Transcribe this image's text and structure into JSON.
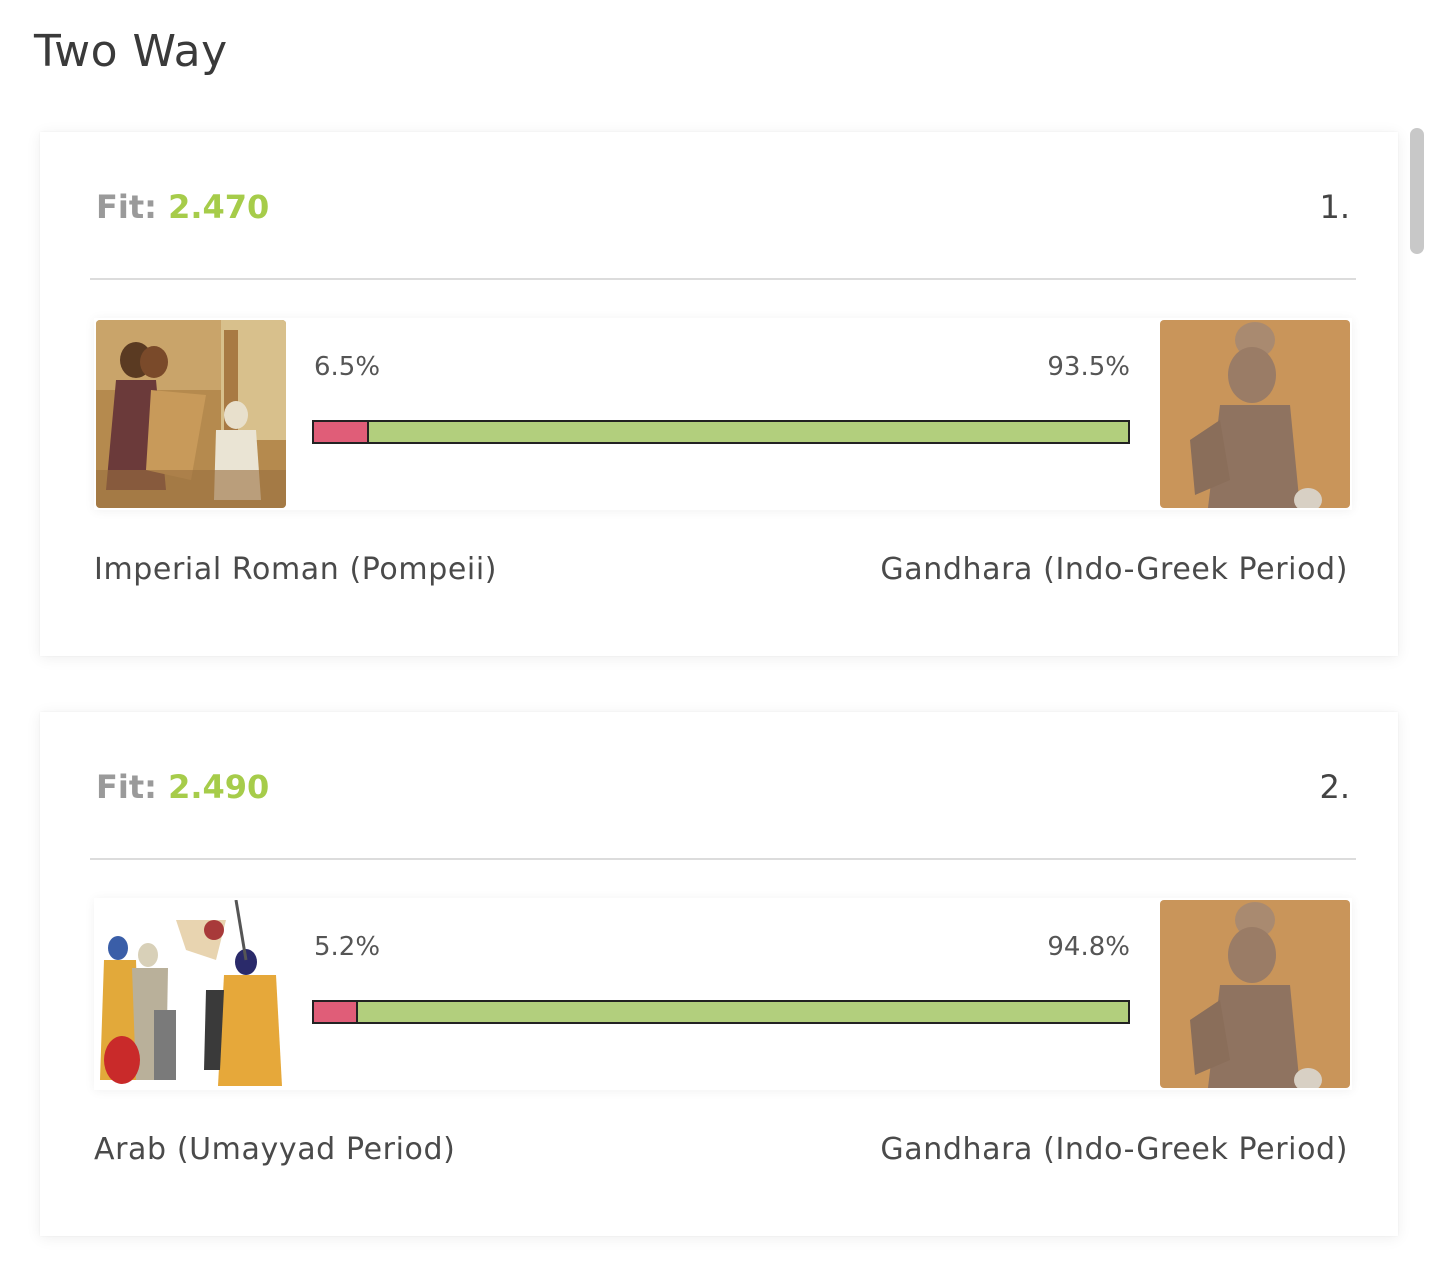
{
  "page": {
    "title": "Two Way"
  },
  "results": [
    {
      "fit_label": "Fit:",
      "fit_value": "2.470",
      "rank": "1.",
      "left": {
        "pct_text": "6.5%",
        "fraction": 0.065,
        "name": "Imperial Roman (Pompeii)",
        "image": "pompeii-fresco-image"
      },
      "right": {
        "pct_text": "93.5%",
        "fraction": 0.935,
        "name": "Gandhara (Indo-Greek Period)",
        "image": "gandhara-statue-image"
      }
    },
    {
      "fit_label": "Fit:",
      "fit_value": "2.490",
      "rank": "2.",
      "left": {
        "pct_text": "5.2%",
        "fraction": 0.052,
        "name": "Arab (Umayyad Period)",
        "image": "umayyad-warriors-image"
      },
      "right": {
        "pct_text": "94.8%",
        "fraction": 0.948,
        "name": "Gandhara (Indo-Greek Period)",
        "image": "gandhara-statue-image"
      }
    }
  ],
  "colors": {
    "fit_value": "#a6cc4a",
    "bar_left": "#e05d78",
    "bar_right": "#b2cf7d"
  }
}
